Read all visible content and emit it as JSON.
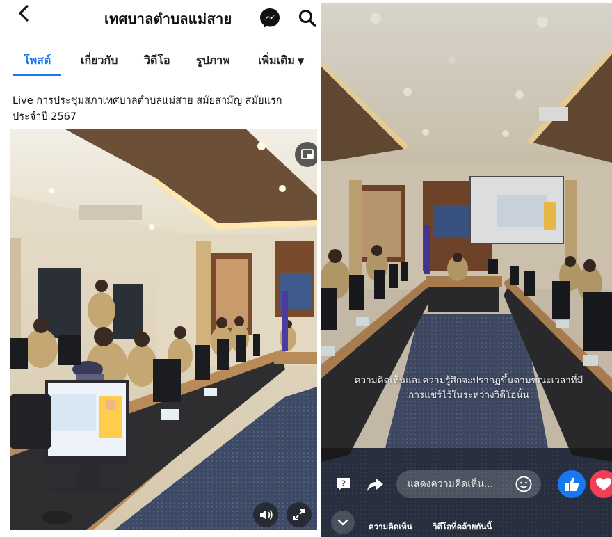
{
  "left": {
    "header": {
      "back_icon": "chevron-left-icon",
      "title": "เทศบาลตำบลแม่สาย",
      "messenger_icon": "messenger-icon",
      "search_icon": "search-icon"
    },
    "tabs": [
      {
        "label": "โพสต์",
        "active": true
      },
      {
        "label": "เกี่ยวกับ",
        "active": false
      },
      {
        "label": "วิดีโอ",
        "active": false
      },
      {
        "label": "รูปภาพ",
        "active": false
      },
      {
        "label": "เพิ่มเติม",
        "active": false
      }
    ],
    "caption_line1": "Live การประชุมสภาเทศบาลตำบลแม่สาย สมัยสามัญ สมัยแรก",
    "caption_line2": "ประจำปี 2567",
    "video": {
      "pip_icon": "picture-in-picture-icon",
      "volume_icon": "volume-icon",
      "fullscreen_icon": "fullscreen-icon"
    }
  },
  "right": {
    "overlay_line1": "ความคิดเห็นและความรู้สึกจะปรากฏขึ้นตามขณะเวลาที่มี",
    "overlay_line2": "การแชร์ไว้ในระหว่างวิดีโอนั้น",
    "comment_placeholder": "แสดงความคิดเห็น...",
    "tabs": [
      "ความคิดเห็น",
      "วิดีโอที่คล้ายกันนี้"
    ],
    "accent": "#1877f2",
    "love_color": "#f33e58"
  }
}
